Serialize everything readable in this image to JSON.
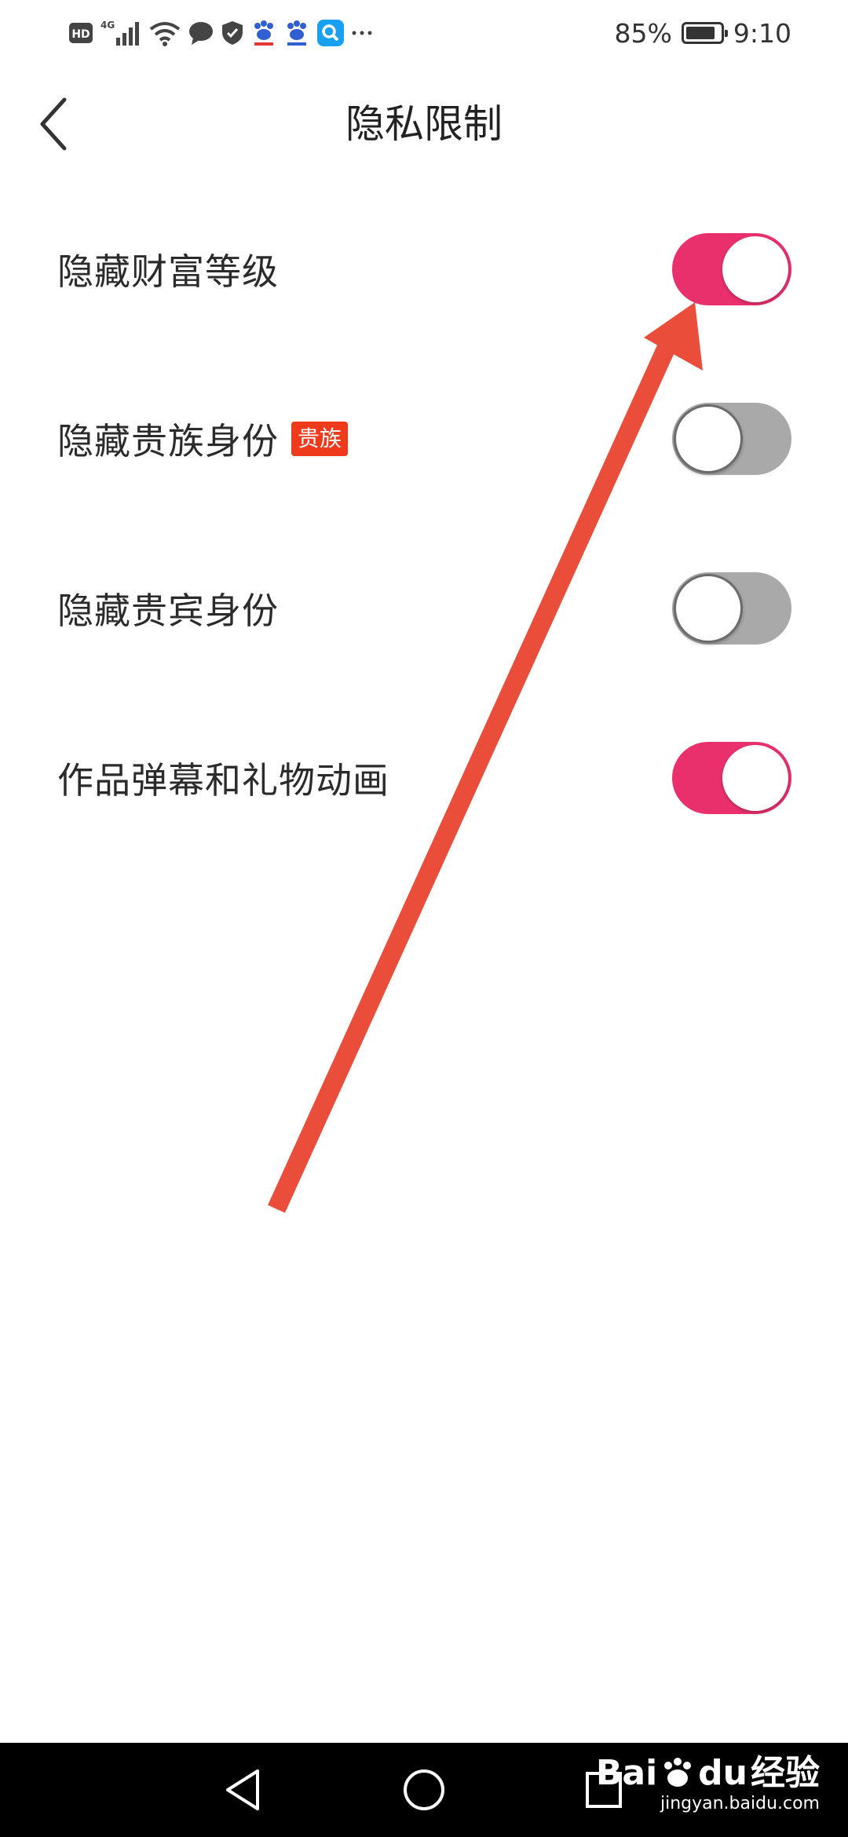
{
  "status_bar": {
    "network_hd": "HD",
    "network_gen": "4G",
    "icons": [
      "hd-icon",
      "signal-icon",
      "wifi-icon",
      "chat-icon",
      "shield-icon",
      "baidu-paw-icon",
      "baidu-paw-icon",
      "search-app-icon",
      "more-dots-icon"
    ],
    "battery_percent": "85%",
    "battery_level": 0.85,
    "time": "9:10"
  },
  "header": {
    "title": "隐私限制",
    "back_icon": "chevron-left-icon"
  },
  "settings": [
    {
      "label": "隐藏财富等级",
      "enabled": true
    },
    {
      "label": "隐藏贵族身份",
      "badge": "贵族",
      "enabled": false
    },
    {
      "label": "隐藏贵宾身份",
      "enabled": false
    },
    {
      "label": "作品弹幕和礼物动画",
      "enabled": true
    }
  ],
  "colors": {
    "toggle_on": "#e9306d",
    "toggle_off": "#a9a9a9",
    "badge": "#f03a1c",
    "annotation_arrow": "#ea4e3a"
  },
  "nav_bar": {
    "buttons": [
      "back-triangle-icon",
      "home-circle-icon",
      "recents-square-icon"
    ],
    "watermark_logo": "Bai",
    "watermark_logo_suffix": "du",
    "watermark_cn": "经验",
    "watermark_url": "jingyan.baidu.com"
  }
}
